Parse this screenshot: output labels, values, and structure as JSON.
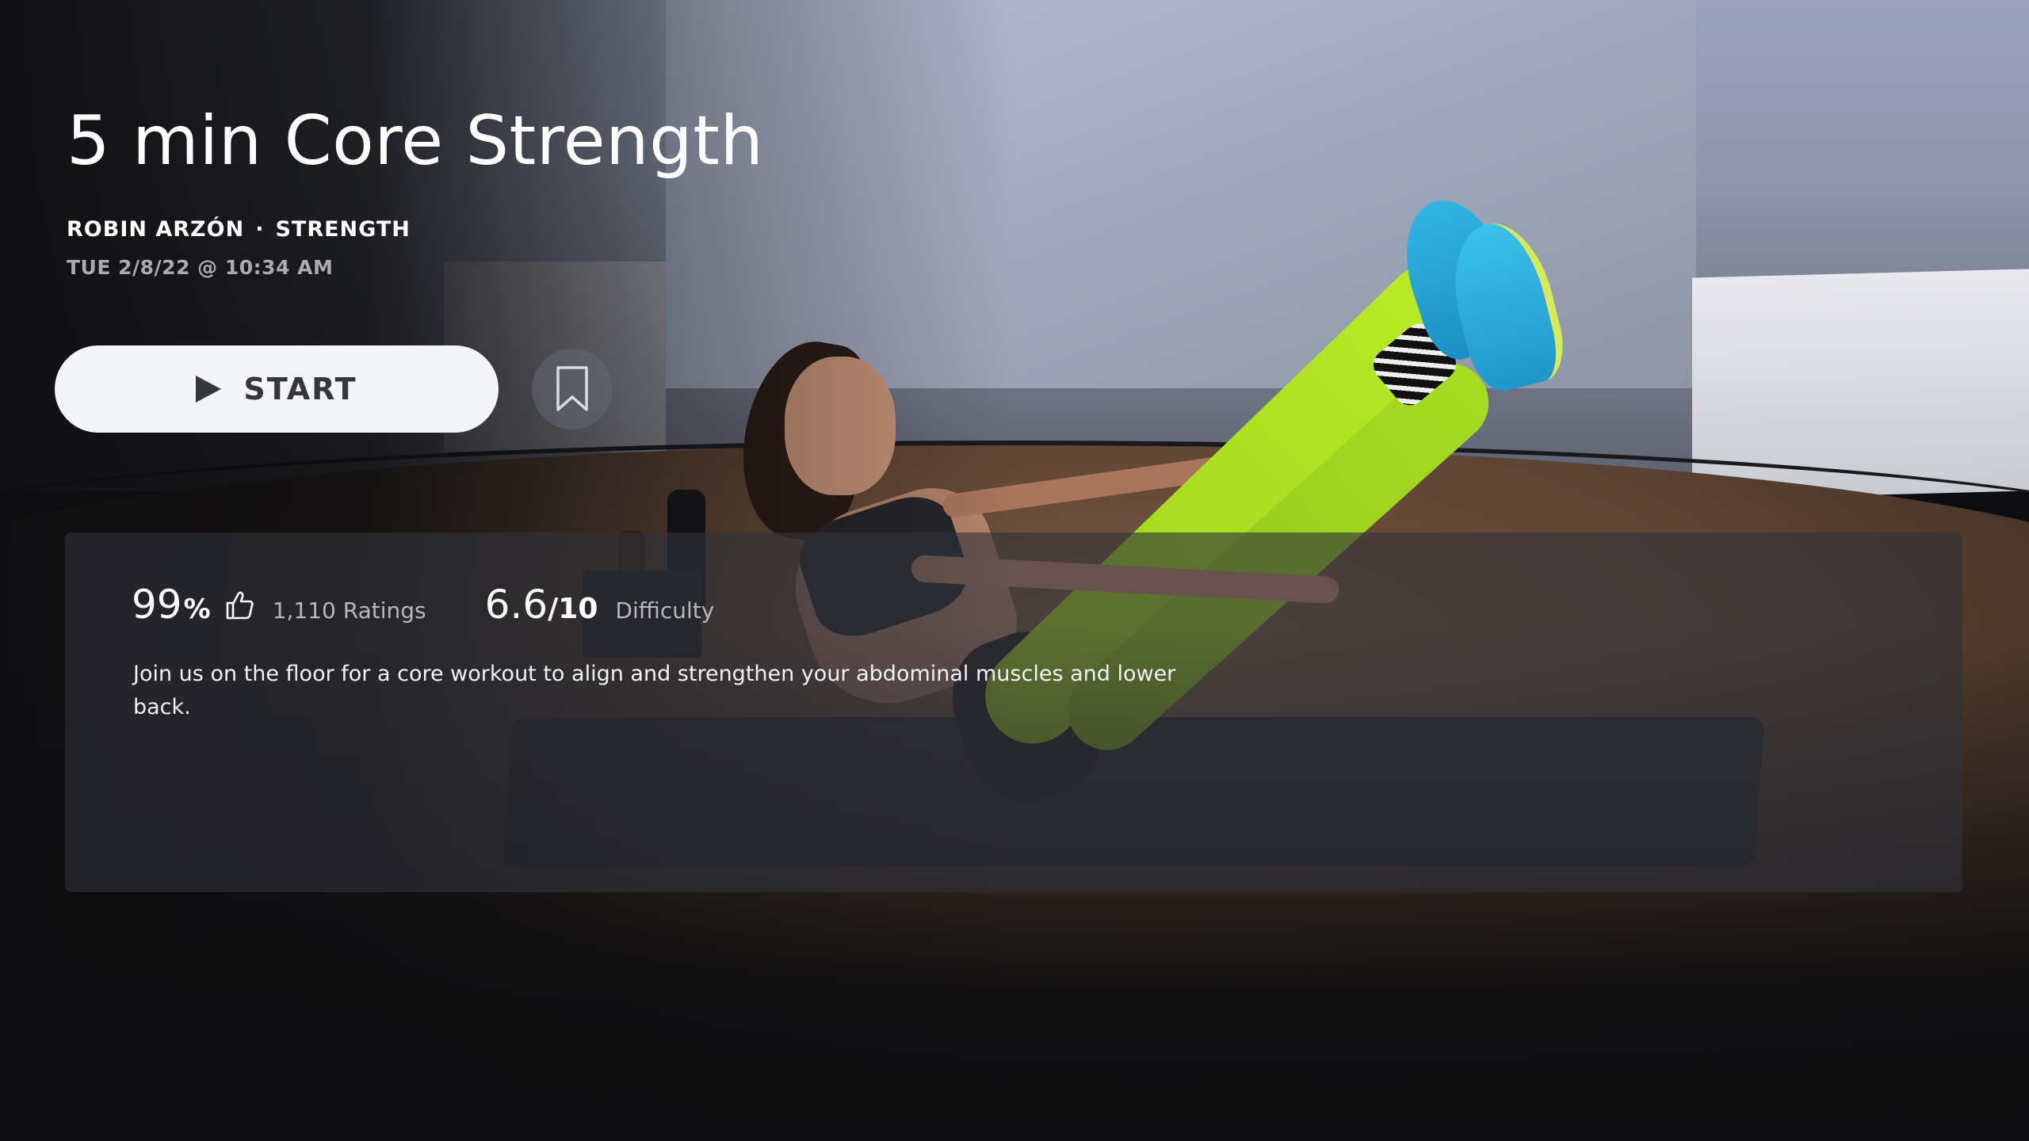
{
  "class": {
    "title": "5 min Core Strength",
    "instructor": "ROBIN ARZÓN",
    "separator": "·",
    "category": "STRENGTH",
    "aired": "TUE 2/8/22 @ 10:34 AM"
  },
  "actions": {
    "start_label": "START",
    "start_icon": "play-icon",
    "bookmark_icon": "bookmark-icon"
  },
  "stats": {
    "rating_value": "99",
    "rating_unit": "%",
    "rating_icon": "thumbs-up-icon",
    "ratings_count": "1,110 Ratings",
    "difficulty_value": "6.6",
    "difficulty_scale": "/10",
    "difficulty_label": "Difficulty"
  },
  "description": "Join us on the floor for a core workout to align and strengthen your abdominal muscles and lower back.",
  "colors": {
    "background": "#0d0d0f",
    "button_bg": "#f4f5f7",
    "button_text": "#36373d",
    "secondary_text": "#a9abb0"
  }
}
